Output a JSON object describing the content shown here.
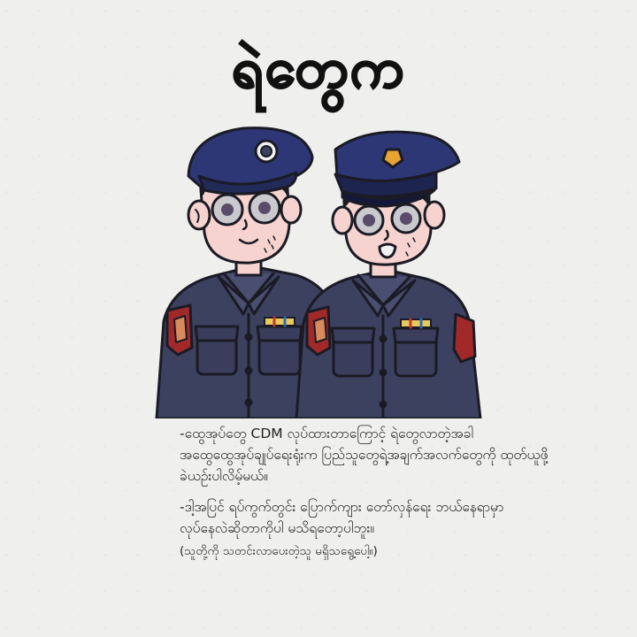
{
  "title": "ရဲတွေက",
  "paragraphs": [
    {
      "lines": [
        "-ထွေအုပ်တွေ CDM လုပ်ထားတာကြောင့်  ရဲတွေလာတဲ့အခါ",
        "အထွေထွေအုပ်ချုပ်ရေးရုံးက ပြည်သူတွေရဲ့အချက်အလက်တွေကို ထုတ်ယူဖို့",
        "ခဲယဉ်းပါလိမ့်မယ်။"
      ]
    },
    {
      "lines": [
        "-ဒါ့အပြင် ရပ်ကွက်တွင်း ပြောက်ကျား တော်လှန်ရေး ဘယ်နေရာမှာ",
        "လုပ်နေလဲဆိုတာကိုပါ မသိရတော့ပါဘူး။"
      ],
      "note": "(သူတို့ကို သတင်းလာပေးတဲ့သူ မရှိသရွေ့ပေါ့။)"
    }
  ],
  "colors": {
    "background": "#efefed",
    "uniform": "#3d4160",
    "cap": "#2e3776",
    "skin": "#f6d3cf",
    "title": "#111111"
  }
}
